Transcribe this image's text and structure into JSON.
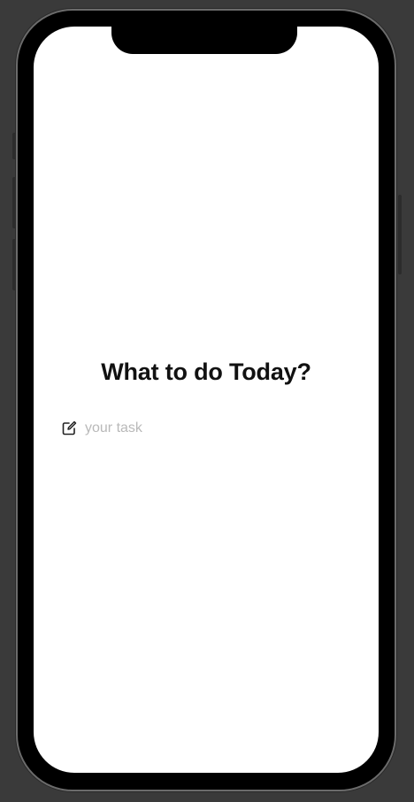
{
  "app": {
    "title": "What to do Today?"
  },
  "task_input": {
    "placeholder": "your task",
    "value": "",
    "icon": "square-and-pencil-icon"
  },
  "colors": {
    "screen_background": "#ffffff",
    "title_text": "#111111",
    "placeholder_text": "#b9b9b9",
    "device_frame": "#000000",
    "outer_background": "#3a3a3a"
  }
}
